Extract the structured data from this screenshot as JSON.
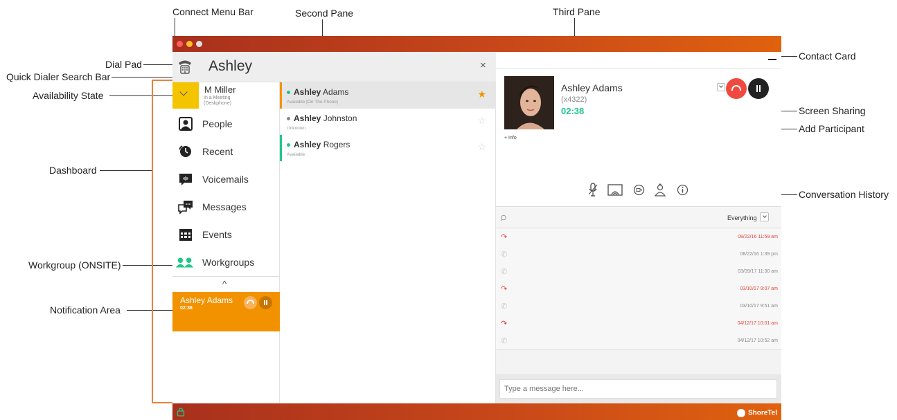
{
  "callouts": {
    "connect_menu_bar": "Connect Menu Bar",
    "second_pane": "Second Pane",
    "third_pane": "Third Pane",
    "dial_pad": "Dial Pad",
    "quick_dialer": "Quick Dialer Search Bar",
    "contact_card": "Contact Card",
    "availability_state": "Availability State",
    "screen_sharing": "Screen Sharing",
    "add_participant": "Add Participant",
    "dashboard": "Dashboard",
    "conversation_history": "Conversation History",
    "workgroup": "Workgroup (ONSITE)",
    "notification_area": "Notification Area"
  },
  "colors": {
    "accent_orange": "#f39200",
    "availability_yellow": "#f5c400",
    "missed_red": "#e8433a",
    "timer_green": "#1ec78a",
    "available_green": "#1ec78a"
  },
  "search": {
    "query": "Ashley",
    "close_icon": "×"
  },
  "user": {
    "name": "M Miller",
    "status_line1": "In a Meeting",
    "status_line2": "(Deskphone)"
  },
  "nav": [
    {
      "label": "People",
      "icon": "people-icon"
    },
    {
      "label": "Recent",
      "icon": "clock-icon"
    },
    {
      "label": "Voicemails",
      "icon": "voicemail-icon"
    },
    {
      "label": "Messages",
      "icon": "messages-icon"
    },
    {
      "label": "Events",
      "icon": "calendar-icon"
    },
    {
      "label": "Workgroups",
      "icon": "workgroup-icon"
    }
  ],
  "expand_glyph": "^",
  "notification": {
    "name": "Ashley Adams",
    "timer": "02:38"
  },
  "contacts": [
    {
      "first": "Ashley",
      "last": "Adams",
      "status": "Available [On The Phone]",
      "dot": "#1ec78a",
      "favorite": true
    },
    {
      "first": "Ashley",
      "last": "Johnston",
      "status": "Unknown",
      "dot": "#888888",
      "favorite": false
    },
    {
      "first": "Ashley",
      "last": "Rogers",
      "status": "Available",
      "dot": "#1ec78a",
      "favorite": false
    }
  ],
  "card": {
    "name": "Ashley Adams",
    "ext": "(x4322)",
    "timer": "02:38",
    "info_link": "+ Info"
  },
  "history": {
    "filter": "Everything",
    "rows": [
      {
        "time": "08/22/16 11:59 am",
        "missed": true
      },
      {
        "time": "08/22/16 1:39 pm",
        "missed": false
      },
      {
        "time": "03/09/17 11:30 am",
        "missed": false
      },
      {
        "time": "03/10/17 9:07 am",
        "missed": true
      },
      {
        "time": "03/10/17 9:51 am",
        "missed": false
      },
      {
        "time": "04/12/17 10:01 am",
        "missed": true
      },
      {
        "time": "04/12/17 10:52 am",
        "missed": false
      }
    ]
  },
  "message_placeholder": "Type a message here...",
  "brand": "ShoreTel"
}
